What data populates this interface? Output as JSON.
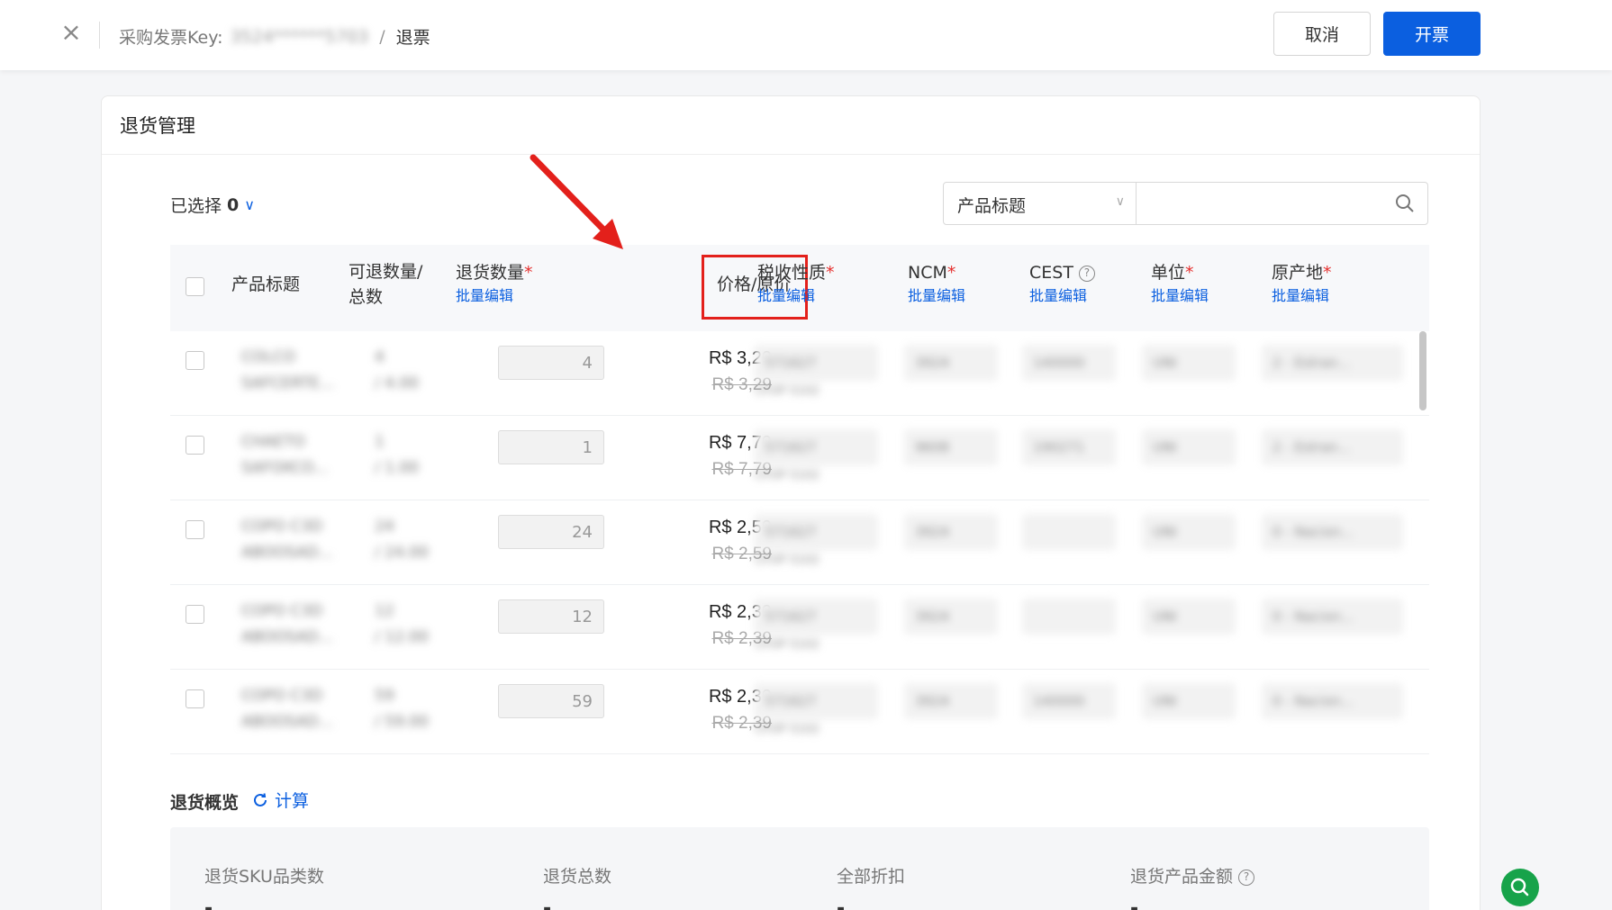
{
  "header": {
    "breadcrumb_prefix": "采购发票Key:",
    "breadcrumb_key": "3524******5703",
    "breadcrumb_sep": "/",
    "breadcrumb_current": "退票",
    "cancel_label": "取消",
    "submit_label": "开票"
  },
  "card": {
    "title": "退货管理"
  },
  "toolbar": {
    "selected_label": "已选择",
    "selected_count": "0",
    "filter_value": "产品标题"
  },
  "table": {
    "headers": {
      "product_title": "产品标题",
      "qty_available": "可退数量/总数",
      "return_qty": "退货数量",
      "price": "价格/原价",
      "tax_nature": "税收性质",
      "ncm": "NCM",
      "cest": "CEST",
      "unit": "单位",
      "origin": "原产地"
    },
    "required_mark": "*",
    "bulk_edit_label": "批量编辑",
    "rows": [
      {
        "title1": "COLCO",
        "title2": "SAFCERTE...",
        "qty1": "4",
        "qty2": "/ 4.00",
        "return_qty": "4",
        "price": "R$ 3,29",
        "original": "R$ 3,29",
        "tax": "571627",
        "cfop": "CFOP 5102",
        "ncm": "3924",
        "cest": "140000",
        "unit": "UNI",
        "origin": "2 - Estran..."
      },
      {
        "title1": "CHAETO",
        "title2": "SAFOXCO...",
        "qty1": "1",
        "qty2": "/ 1.00",
        "return_qty": "1",
        "price": "R$ 7,79",
        "original": "R$ 7,79",
        "tax": "571627",
        "cfop": "CFOP 5102",
        "ncm": "9608",
        "cest": "190271",
        "unit": "UNI",
        "origin": "2 - Estran..."
      },
      {
        "title1": "COPO C3D",
        "title2": "ABOOSAD...",
        "qty1": "24",
        "qty2": "/ 24.00",
        "return_qty": "24",
        "price": "R$ 2,59",
        "original": "R$ 2,59",
        "tax": "571627",
        "cfop": "CFOP 5102",
        "ncm": "3924",
        "cest": "",
        "unit": "UNI",
        "origin": "0 - Nacion..."
      },
      {
        "title1": "COPO C3D",
        "title2": "ABOOSAD...",
        "qty1": "12",
        "qty2": "/ 12.00",
        "return_qty": "12",
        "price": "R$ 2,39",
        "original": "R$ 2,39",
        "tax": "571627",
        "cfop": "CFOP 5102",
        "ncm": "3924",
        "cest": "",
        "unit": "UNI",
        "origin": "0 - Nacion..."
      },
      {
        "title1": "COPO C3D",
        "title2": "ABOOSAD...",
        "qty1": "59",
        "qty2": "/ 59.00",
        "return_qty": "59",
        "price": "R$ 2,39",
        "original": "R$ 2,39",
        "tax": "571627",
        "cfop": "CFOP 5102",
        "ncm": "3924",
        "cest": "140000",
        "unit": "UNI",
        "origin": "0 - Nacion..."
      }
    ]
  },
  "overview": {
    "title": "退货概览",
    "calc_label": "计算",
    "items": [
      {
        "label": "退货SKU品类数",
        "value": "-"
      },
      {
        "label": "退货总数",
        "value": "-"
      },
      {
        "label": "全部折扣",
        "value": "-"
      },
      {
        "label": "退货产品金额",
        "value": "-"
      }
    ]
  },
  "colors": {
    "primary": "#0b5fe0",
    "required": "#e5302e",
    "annotation": "#e3201b",
    "fab": "#17a34a"
  }
}
